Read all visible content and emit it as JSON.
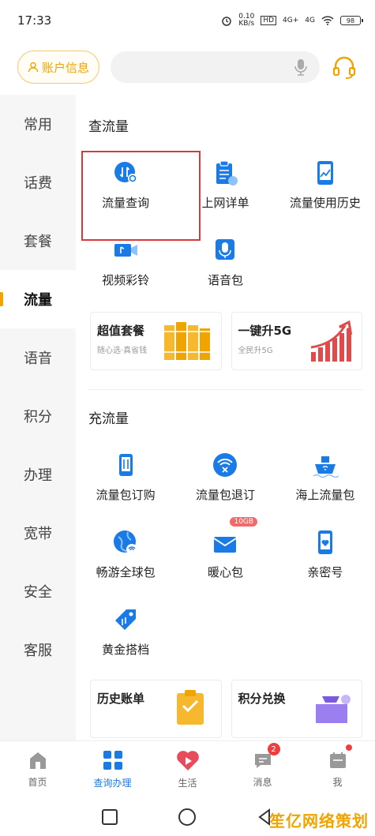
{
  "status": {
    "time": "17:33",
    "speed": "0.10",
    "speed_unit": "KB/s",
    "hd": "HD",
    "net1": "4G+",
    "net2": "4G",
    "battery": "98"
  },
  "header": {
    "account_label": "账户信息",
    "search_placeholder": ""
  },
  "sidebar": {
    "items": [
      {
        "label": "常用"
      },
      {
        "label": "话费"
      },
      {
        "label": "套餐"
      },
      {
        "label": "流量"
      },
      {
        "label": "语音"
      },
      {
        "label": "积分"
      },
      {
        "label": "办理"
      },
      {
        "label": "宽带"
      },
      {
        "label": "安全"
      },
      {
        "label": "客服"
      }
    ],
    "active_index": 3
  },
  "query_section": {
    "title": "查流量",
    "items": [
      {
        "label": "流量查询",
        "icon": "traffic-query-icon"
      },
      {
        "label": "上网详单",
        "icon": "clipboard-icon"
      },
      {
        "label": "流量使用历史",
        "icon": "phone-chart-icon"
      },
      {
        "label": "视频彩铃",
        "icon": "video-icon"
      },
      {
        "label": "语音包",
        "icon": "microphone-icon"
      }
    ],
    "promos": [
      {
        "title": "超值套餐",
        "sub": "随心选·真省钱",
        "icon": "books-icon"
      },
      {
        "title": "一键升5G",
        "sub": "全民升5G",
        "icon": "growth-chart-icon"
      }
    ]
  },
  "recharge_section": {
    "title": "充流量",
    "items": [
      {
        "label": "流量包订购",
        "icon": "phone-data-icon"
      },
      {
        "label": "流量包退订",
        "icon": "wifi-cancel-icon"
      },
      {
        "label": "海上流量包",
        "icon": "ship-icon"
      },
      {
        "label": "畅游全球包",
        "icon": "globe-icon"
      },
      {
        "label": "暖心包",
        "icon": "envelope-icon",
        "badge": "10GB"
      },
      {
        "label": "亲密号",
        "icon": "heart-phone-icon"
      },
      {
        "label": "黄金搭档",
        "icon": "tag-icon"
      }
    ],
    "promos": [
      {
        "title": "历史账单",
        "icon": "bill-icon"
      },
      {
        "title": "积分兑换",
        "icon": "gift-icon"
      }
    ]
  },
  "tabbar": {
    "items": [
      {
        "label": "首页"
      },
      {
        "label": "查询办理"
      },
      {
        "label": "生活"
      },
      {
        "label": "消息",
        "badge": "2"
      },
      {
        "label": "我"
      }
    ],
    "active_index": 1
  },
  "colors": {
    "accent": "#f0a400",
    "active_tab": "#1a7be6",
    "icon_blue": "#1a7be6",
    "highlight": "#d63a3a"
  },
  "watermark": "笙亿网络策划"
}
